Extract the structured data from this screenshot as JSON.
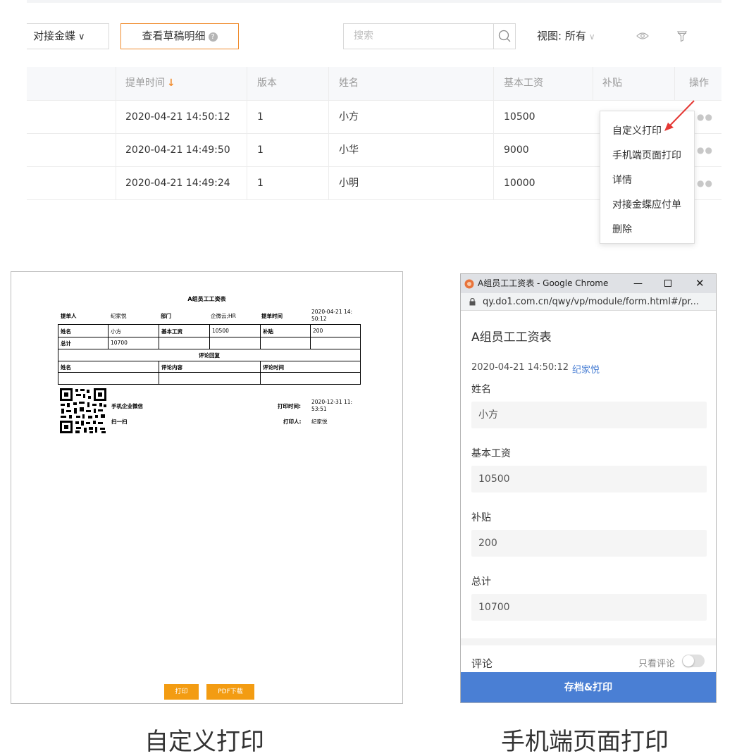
{
  "toolbar": {
    "jindie_label": "对接金蝶",
    "draft_label": "查看草稿明细",
    "search_placeholder": "搜索",
    "view_label": "视图: 所有"
  },
  "table": {
    "headers": [
      "提单时间",
      "版本",
      "姓名",
      "基本工资",
      "补贴",
      "操作"
    ],
    "rows": [
      {
        "time": "2020-04-21 14:50:12",
        "version": "1",
        "name": "小方",
        "salary": "10500"
      },
      {
        "time": "2020-04-21 14:49:50",
        "version": "1",
        "name": "小华",
        "salary": "9000"
      },
      {
        "time": "2020-04-21 14:49:24",
        "version": "1",
        "name": "小明",
        "salary": "10000"
      }
    ]
  },
  "menu": {
    "items": [
      "自定义打印",
      "手机端页面打印",
      "详情",
      "对接金蝶应付单",
      "删除"
    ]
  },
  "print_preview": {
    "title": "A组员工工资表",
    "submitter_label": "提单人",
    "submitter": "纪家悦",
    "dept_label": "部门",
    "dept": "企微云;HR",
    "time_label": "提单时间",
    "time_line1": "2020-04-21 14:",
    "time_line2": "50:12",
    "name_label": "姓名",
    "name": "小方",
    "salary_label": "基本工资",
    "salary": "10500",
    "allowance_label": "补贴",
    "allowance": "200",
    "total_label": "总计",
    "total": "10700",
    "comments_header": "评论回复",
    "comment_name_label": "姓名",
    "comment_content_label": "评论内容",
    "comment_time_label": "评论时间",
    "wechat_label": "手机企业微信",
    "scan_label": "扫一扫",
    "print_time_label": "打印时间:",
    "print_time_line1": "2020-12-31 11:",
    "print_time_line2": "53:51",
    "printer_label": "打印人:",
    "printer": "纪家悦",
    "print_button": "打印",
    "pdf_button": "PDF下载"
  },
  "chrome": {
    "window_title": "A组员工工资表 - Google Chrome",
    "url": "qy.do1.com.cn/qwy/vp/module/form.html#/pr...",
    "form_title": "A组员工工资表",
    "timestamp": "2020-04-21 14:50:12",
    "author": "纪家悦",
    "fields": [
      {
        "label": "姓名",
        "value": "小方"
      },
      {
        "label": "基本工资",
        "value": "10500"
      },
      {
        "label": "补贴",
        "value": "200"
      },
      {
        "label": "总计",
        "value": "10700"
      }
    ],
    "comment_label": "评论",
    "only_comments_label": "只看评论",
    "submit_label": "存档&打印"
  },
  "captions": {
    "left": "自定义打印",
    "right": "手机端页面打印"
  },
  "colors": {
    "accent_orange": "#f08c2e",
    "print_button": "#f39c12",
    "submit_blue": "#4a7fd4",
    "annotation_arrow": "#e53935"
  }
}
